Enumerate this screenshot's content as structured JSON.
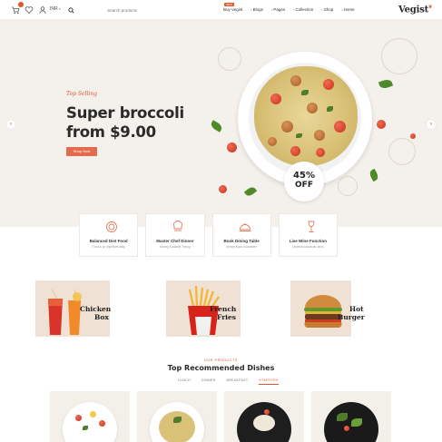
{
  "header": {
    "currency": "INR",
    "search_placeholder": "Search products",
    "nav": [
      {
        "label": "Buy Vegist",
        "badge": "NEW"
      },
      {
        "label": "Blogs"
      },
      {
        "label": "Pages"
      },
      {
        "label": "Collection"
      },
      {
        "label": "Shop"
      },
      {
        "label": "Home"
      }
    ],
    "logo": "Vegist"
  },
  "hero": {
    "tag": "Top Selling",
    "title_line1": "Super broccoli",
    "title_line2": "from $9.00",
    "button": "Shop Now",
    "badge_percent": "45%",
    "badge_off": "OFF"
  },
  "features": [
    {
      "title": "Balanced Diet Food",
      "sub": "Food is an important daily",
      "icon": "plate-icon"
    },
    {
      "title": "Master Chef Dinner",
      "sub": "Money Available Timing",
      "icon": "chef-hat-icon"
    },
    {
      "title": "Book Dining Table",
      "sub": "Money Book Guarantee",
      "icon": "cloche-icon"
    },
    {
      "title": "Live Wine Function",
      "sub": "Unlimited alcoholic drink",
      "icon": "wine-icon"
    }
  ],
  "categories": [
    {
      "line1": "Chicken",
      "line2": "Box"
    },
    {
      "line1": "French",
      "line2": "Fries"
    },
    {
      "line1": "Hot",
      "line2": "Burger"
    }
  ],
  "section": {
    "kicker": "OUR PRODUCTS",
    "title": "Top Recommended Dishes",
    "tabs": [
      "LUNCH",
      "DINNER",
      "BREAKFAST",
      "STARTERS"
    ],
    "active_tab": "STARTERS"
  },
  "colors": {
    "accent": "#e0562f",
    "hero_bg": "#f4f1ec",
    "category_bg": "#efe1d4"
  }
}
